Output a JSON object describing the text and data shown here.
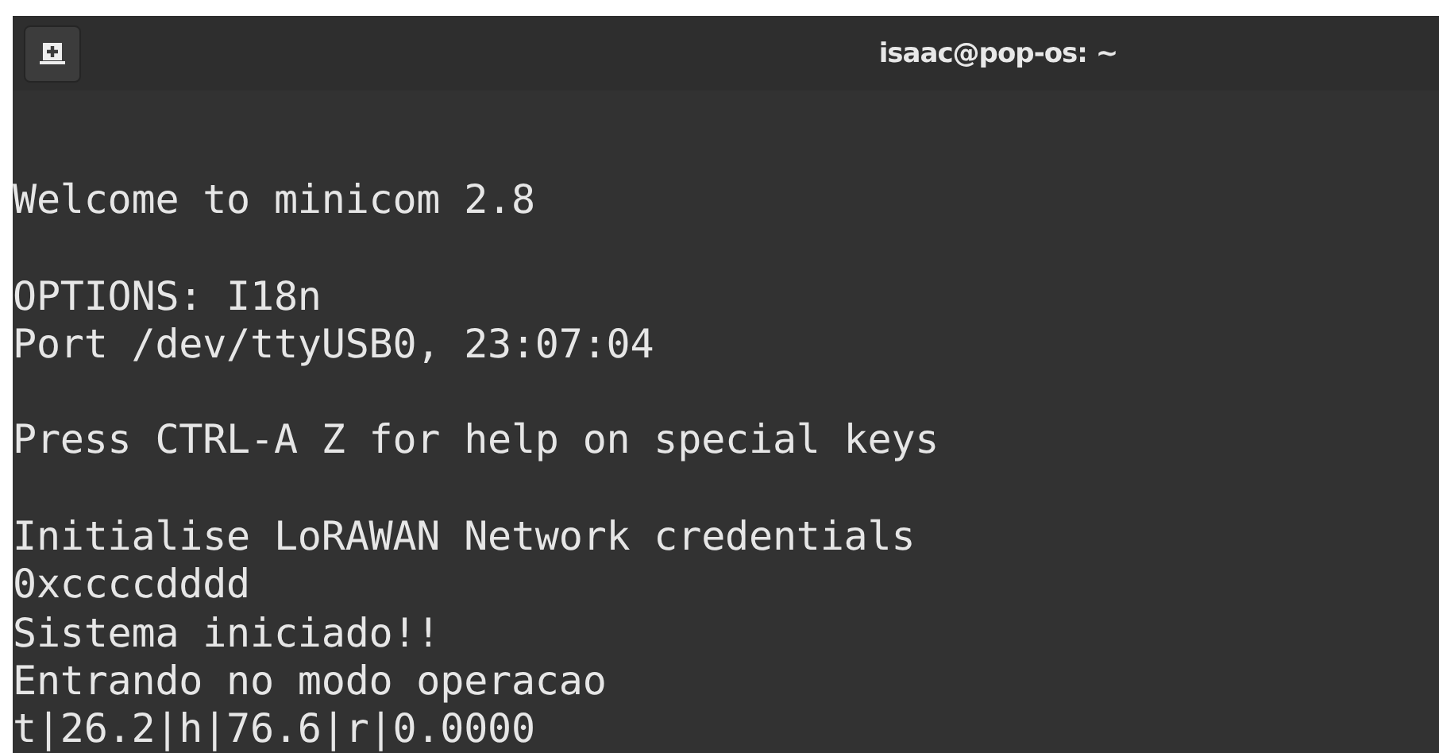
{
  "window": {
    "title": "isaac@pop-os: ~"
  },
  "terminal": {
    "paragraphs": [
      [
        "Welcome to minicom 2.8"
      ],
      [
        "OPTIONS: I18n",
        "Port /dev/ttyUSB0, 23:07:04"
      ],
      [
        "Press CTRL-A Z for help on special keys"
      ],
      [
        "Initialise LoRAWAN Network credentials",
        "0xccccdddd",
        "Sistema iniciado!!",
        "Entrando no modo operacao",
        "t|26.2|h|76.6|r|0.0000"
      ]
    ]
  }
}
